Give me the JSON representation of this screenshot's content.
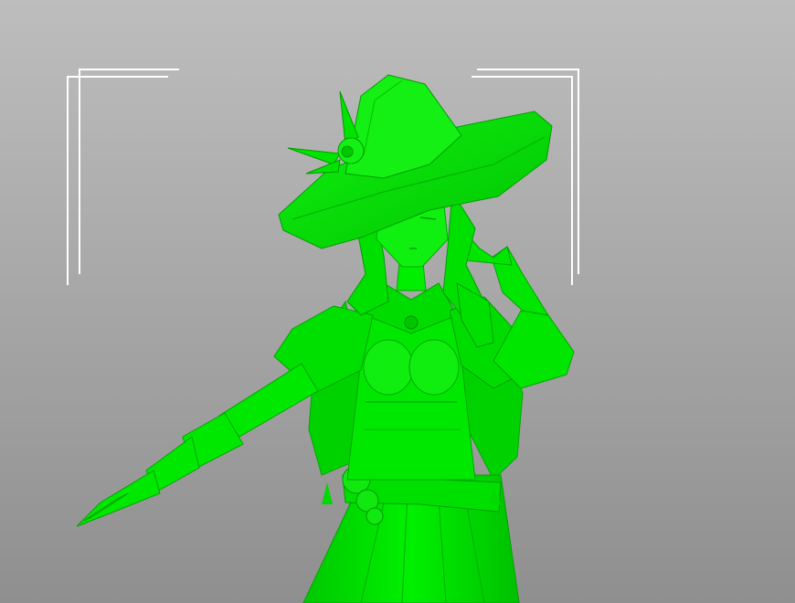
{
  "viewport": {
    "background_top": "#bdbdbd",
    "background_bottom": "#8f8f8f"
  },
  "model": {
    "kind": "witch-character-mesh",
    "color": "#00e600",
    "shade_dark": "#00b800",
    "shade_light": "#33ff33"
  },
  "frame_guides": {
    "color": "#ffffff",
    "corners": [
      "top-left",
      "top-right"
    ]
  }
}
